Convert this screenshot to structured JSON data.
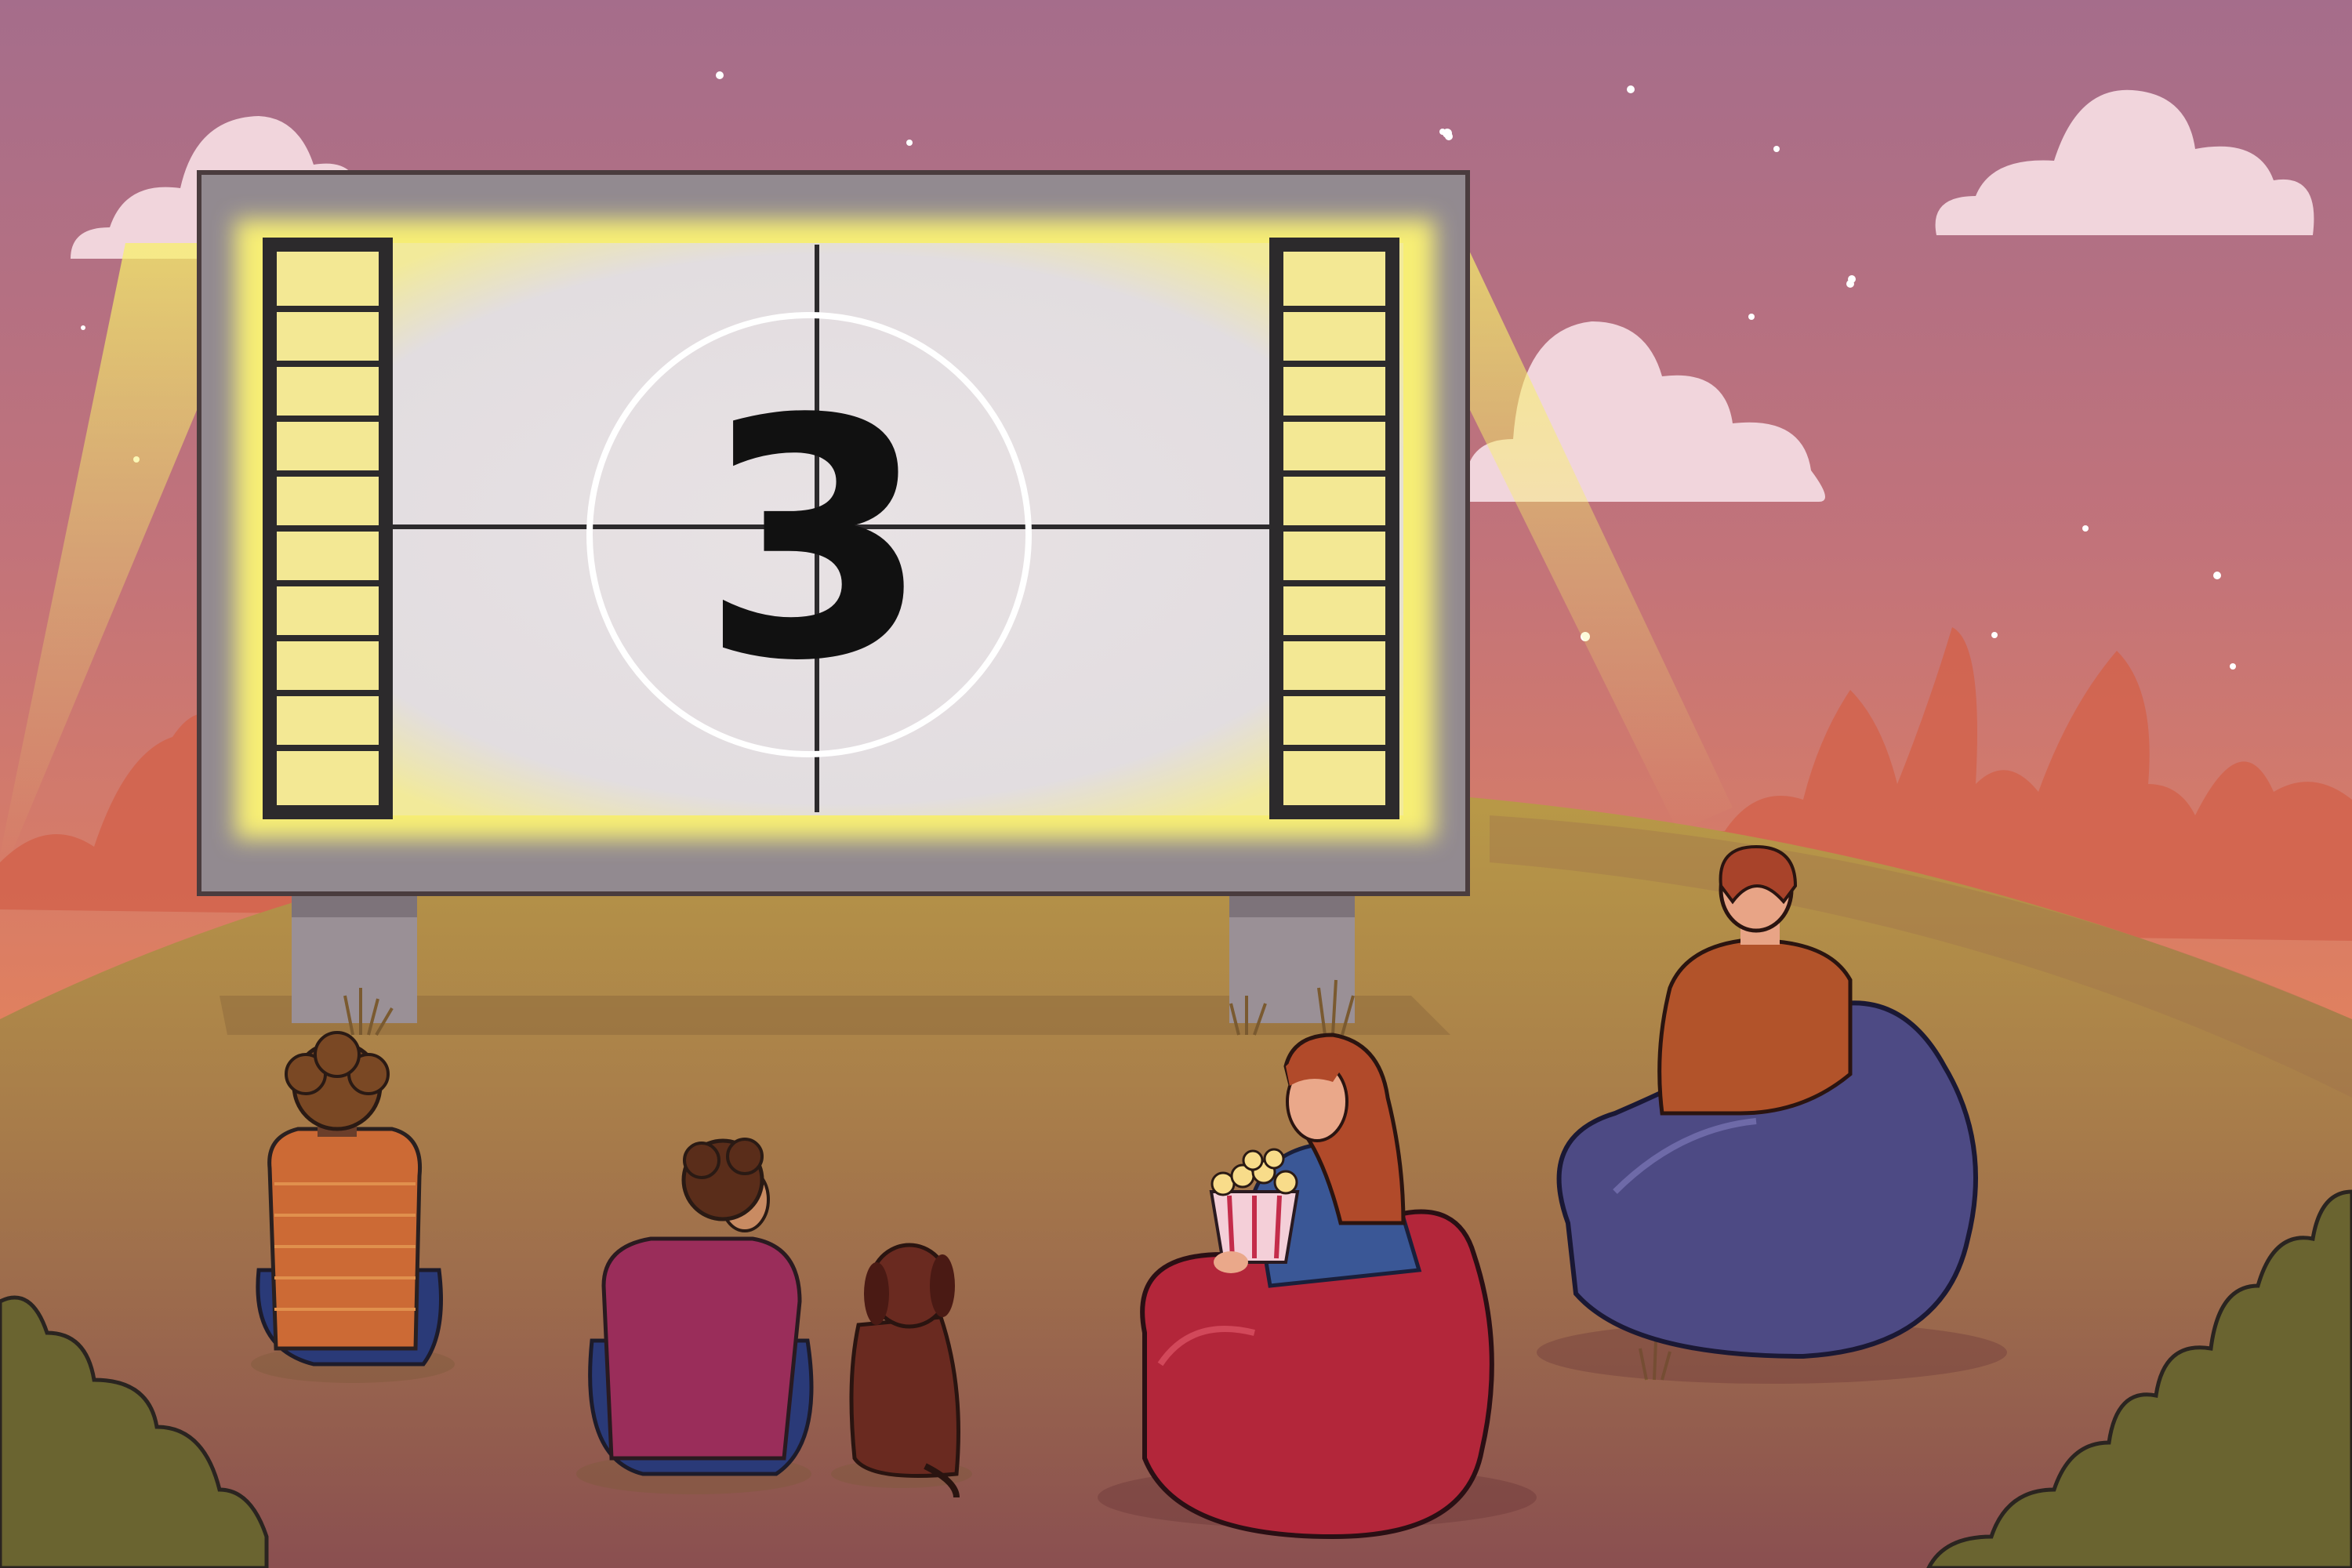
{
  "screen": {
    "countdown_number": "3"
  },
  "colors": {
    "sky_top": "#a66e8a",
    "sky_mid": "#d4746a",
    "sky_bottom": "#e98a55",
    "hill": "#b79545",
    "ground": "#9b6a4a",
    "screen_light": "#f4e86a",
    "screen_face": "#e4dde0",
    "beanbag_red": "#b3263a",
    "beanbag_blue": "#4d4a84"
  },
  "icons": {
    "popcorn": "popcorn-bucket-icon",
    "dog": "dog-icon"
  }
}
